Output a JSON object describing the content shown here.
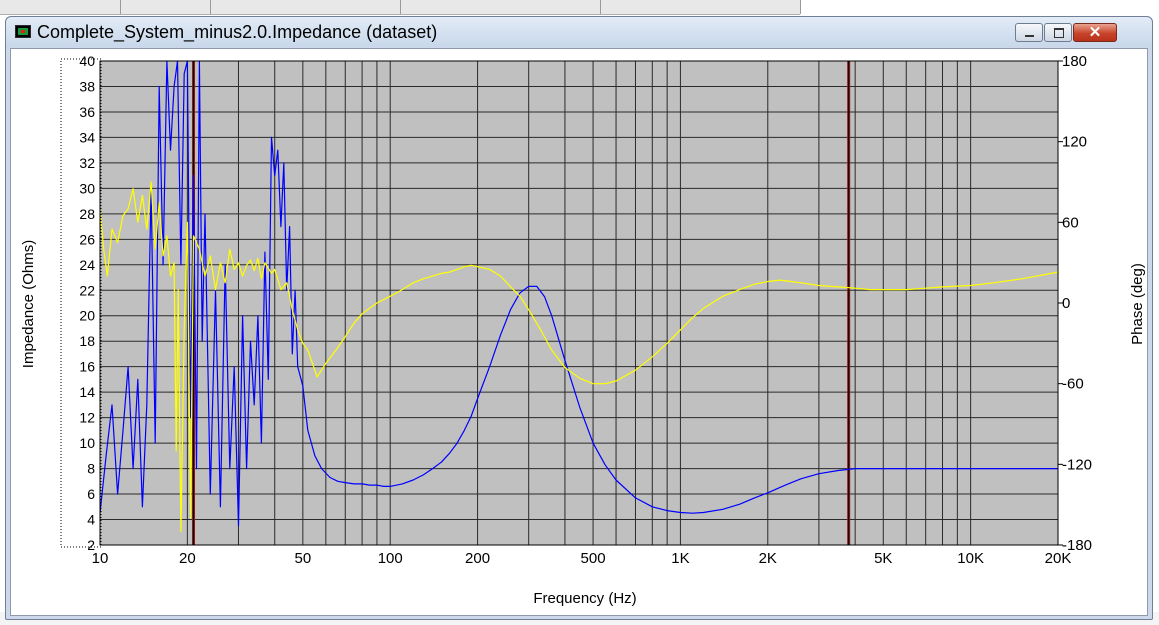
{
  "window": {
    "title": "Complete_System_minus2.0.Impedance (dataset)",
    "close_glyph": "✕",
    "controls": [
      "minimize-icon",
      "maximize-icon",
      "close-icon"
    ],
    "colors": {
      "frame": "#cdd9ea",
      "close": "#c7442a"
    }
  },
  "chart_data": {
    "type": "line",
    "xlabel": "Frequency (Hz)",
    "ylabel_left": "Impedance (Ohms)",
    "ylabel_right": "Phase (deg)",
    "x_scale": "log",
    "xlim": [
      10,
      20000
    ],
    "ylim_left": [
      2,
      40
    ],
    "ylim_right": [
      -180,
      180
    ],
    "grid": true,
    "plot_background": "#c0c0c0",
    "x_ticks": [
      {
        "value": 10,
        "label": "10"
      },
      {
        "value": 20,
        "label": "20"
      },
      {
        "value": 50,
        "label": "50"
      },
      {
        "value": 100,
        "label": "100"
      },
      {
        "value": 200,
        "label": "200"
      },
      {
        "value": 500,
        "label": "500"
      },
      {
        "value": 1000,
        "label": "1K"
      },
      {
        "value": 2000,
        "label": "2K"
      },
      {
        "value": 5000,
        "label": "5K"
      },
      {
        "value": 10000,
        "label": "10K"
      },
      {
        "value": 20000,
        "label": "20K"
      }
    ],
    "y_ticks_left": [
      "2",
      "4",
      "6",
      "8",
      "10",
      "12",
      "14",
      "16",
      "18",
      "20",
      "22",
      "24",
      "26",
      "28",
      "30",
      "32",
      "34",
      "36",
      "38",
      "40"
    ],
    "y_ticks_right": [
      "-180",
      "-120",
      "-60",
      "0",
      "60",
      "120",
      "180"
    ],
    "markers": [
      {
        "x": 21,
        "color": "#8b1a1a"
      },
      {
        "x": 3800,
        "color": "#8b1a1a"
      }
    ],
    "series": [
      {
        "color": "#0000ff",
        "axis": "left",
        "x": [
          10,
          10.5,
          11,
          11.5,
          12,
          12.5,
          13,
          13.5,
          14,
          14.5,
          15,
          15.5,
          16,
          16.5,
          17,
          17.5,
          18,
          18.5,
          19,
          19.5,
          20,
          20.5,
          21,
          21.5,
          22,
          22.5,
          23,
          24,
          25,
          26,
          27,
          28,
          29,
          30,
          31,
          32,
          33,
          34,
          35,
          36,
          37,
          38,
          39,
          40,
          41,
          42,
          43,
          44,
          45,
          46,
          47,
          48,
          50,
          52,
          55,
          58,
          62,
          66,
          70,
          75,
          80,
          85,
          90,
          95,
          100,
          110,
          120,
          130,
          140,
          150,
          160,
          170,
          180,
          190,
          200,
          220,
          240,
          260,
          280,
          300,
          320,
          340,
          360,
          380,
          400,
          450,
          500,
          550,
          600,
          700,
          800,
          900,
          1000,
          1100,
          1200,
          1400,
          1600,
          1800,
          2000,
          2300,
          2600,
          3000,
          3500,
          4000,
          5000,
          6000,
          8000,
          10000,
          12000,
          15000,
          20000
        ],
        "y": [
          4.5,
          9,
          13,
          6,
          11,
          16,
          8,
          15,
          5,
          13,
          30,
          10,
          38,
          24,
          40,
          33,
          38,
          40,
          24,
          39,
          40,
          12,
          31,
          8,
          40,
          18,
          28,
          6,
          22,
          5,
          24,
          8,
          16,
          3.5,
          20,
          8,
          18,
          13,
          20,
          10,
          25,
          15,
          34,
          31,
          33,
          27,
          32,
          22,
          27,
          17,
          22,
          16,
          14.5,
          11,
          9,
          8,
          7.3,
          7,
          6.9,
          6.8,
          6.8,
          6.7,
          6.7,
          6.6,
          6.6,
          6.8,
          7.1,
          7.5,
          8.0,
          8.5,
          9.2,
          10,
          11,
          12.1,
          13.5,
          16,
          18.5,
          20.5,
          21.8,
          22.3,
          22.3,
          21.5,
          20,
          18.2,
          16.5,
          12.8,
          10,
          8.3,
          7.1,
          5.7,
          5.0,
          4.7,
          4.55,
          4.5,
          4.55,
          4.8,
          5.2,
          5.7,
          6.1,
          6.7,
          7.2,
          7.6,
          7.85,
          8.0,
          8.0,
          8.0,
          8.0,
          8.0,
          8.0,
          8.0,
          8.0
        ]
      },
      {
        "color": "#ffff00",
        "axis": "right",
        "x": [
          10,
          10.3,
          10.6,
          11,
          11.5,
          12,
          12.5,
          13,
          13.5,
          14,
          14.5,
          15,
          15.5,
          16,
          16.5,
          17,
          17.5,
          18,
          18.3,
          18.6,
          19,
          19.5,
          20,
          20.5,
          21,
          22,
          23,
          24,
          25,
          26,
          27,
          28,
          29,
          30,
          31,
          32,
          33,
          34,
          35,
          36,
          37,
          38,
          39,
          40,
          42,
          44,
          46,
          48,
          50,
          52,
          54,
          56,
          60,
          65,
          70,
          75,
          80,
          90,
          100,
          110,
          120,
          130,
          140,
          150,
          160,
          170,
          180,
          190,
          200,
          220,
          240,
          260,
          280,
          300,
          330,
          360,
          400,
          450,
          500,
          550,
          600,
          700,
          800,
          900,
          1000,
          1100,
          1200,
          1400,
          1600,
          1800,
          2000,
          2200,
          2400,
          2600,
          3000,
          3500,
          4000,
          4500,
          5000,
          6000,
          7000,
          8000,
          10000,
          12000,
          15000,
          20000
        ],
        "y": [
          70,
          40,
          20,
          55,
          45,
          65,
          70,
          85,
          60,
          80,
          55,
          90,
          40,
          75,
          35,
          50,
          20,
          30,
          -110,
          10,
          -170,
          -20,
          60,
          -160,
          50,
          40,
          20,
          35,
          10,
          30,
          15,
          40,
          25,
          30,
          20,
          28,
          32,
          24,
          33,
          18,
          30,
          26,
          22,
          25,
          10,
          15,
          -5,
          -20,
          -30,
          -35,
          -45,
          -55,
          -45,
          -35,
          -25,
          -15,
          -8,
          0,
          5,
          10,
          15,
          18,
          20,
          22,
          23,
          25,
          27,
          28,
          27,
          25,
          20,
          12,
          5,
          -5,
          -20,
          -35,
          -48,
          -56,
          -60,
          -60,
          -58,
          -50,
          -40,
          -30,
          -20,
          -11,
          -4,
          5,
          10,
          14,
          16,
          17,
          16,
          15,
          13,
          12,
          11,
          10,
          10,
          10,
          11,
          12,
          13,
          15,
          18,
          23
        ]
      }
    ]
  }
}
